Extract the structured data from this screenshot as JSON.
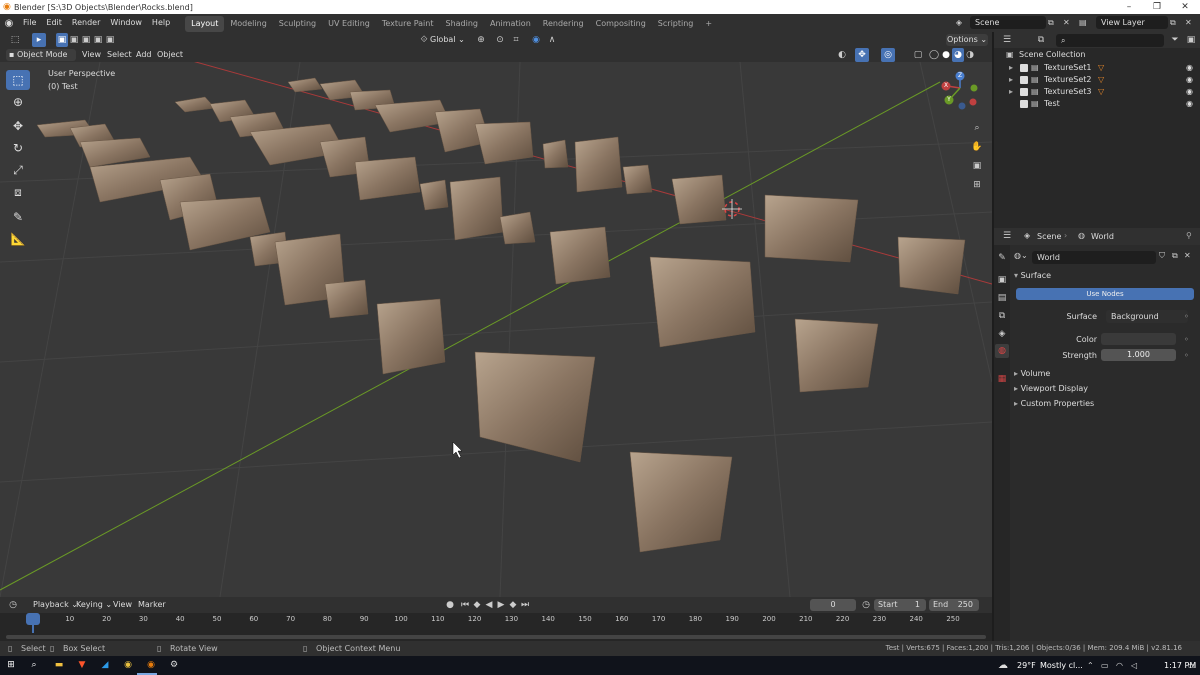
{
  "window": {
    "title": "Blender [S:\\3D Objects\\Blender\\Rocks.blend]",
    "minimize": "–",
    "maximize": "❐",
    "close": "✕"
  },
  "topbar": {
    "menus": [
      "File",
      "Edit",
      "Render",
      "Window",
      "Help"
    ],
    "workspaces": [
      "Layout",
      "Modeling",
      "Sculpting",
      "UV Editing",
      "Texture Paint",
      "Shading",
      "Animation",
      "Rendering",
      "Compositing",
      "Scripting"
    ],
    "active_workspace": "Layout",
    "add_workspace": "+",
    "scene": "Scene",
    "view_layer": "View Layer"
  },
  "tool_header": {
    "transform_orientation": "Global",
    "options": "Options"
  },
  "viewport_header": {
    "mode": "Object Mode",
    "menus": [
      "View",
      "Select",
      "Add",
      "Object"
    ]
  },
  "viewport": {
    "view_name": "User Perspective",
    "collection_info": "(0) Test",
    "gizmo": {
      "x": "X",
      "y": "Y",
      "z": "Z"
    }
  },
  "outliner": {
    "root": "Scene Collection",
    "items": [
      {
        "name": "TextureSet1"
      },
      {
        "name": "TextureSet2"
      },
      {
        "name": "TextureSet3"
      },
      {
        "name": "Test"
      }
    ]
  },
  "properties": {
    "breadcrumb_scene": "Scene",
    "breadcrumb_world": "World",
    "world_name": "World",
    "surface_panel": "Surface",
    "use_nodes": "Use Nodes",
    "surface_label": "Surface",
    "surface_value": "Background",
    "color_label": "Color",
    "strength_label": "Strength",
    "strength_value": "1.000",
    "collapsed_panels": [
      "Volume",
      "Viewport Display",
      "Custom Properties"
    ]
  },
  "timeline": {
    "menus": [
      "Playback",
      "Keying",
      "View",
      "Marker"
    ],
    "current_frame": "0",
    "start_label": "Start",
    "start_value": "1",
    "end_label": "End",
    "end_value": "250",
    "ticks": [
      "0",
      "10",
      "20",
      "30",
      "40",
      "50",
      "60",
      "70",
      "80",
      "90",
      "100",
      "110",
      "120",
      "130",
      "140",
      "150",
      "160",
      "170",
      "180",
      "190",
      "200",
      "210",
      "220",
      "230",
      "240",
      "250"
    ]
  },
  "statusbar": {
    "select": "Select",
    "box_select": "Box Select",
    "rotate_view": "Rotate View",
    "context_menu": "Object Context Menu",
    "stats": "Test | Verts:675 | Faces:1,200 | Tris:1,206 | Objects:0/36 | Mem: 209.4 MiB | v2.81.16"
  },
  "taskbar": {
    "weather_temp": "29°F",
    "weather_text": "Mostly cl...",
    "time": "1:17 PM"
  },
  "colors": {
    "accent_blue": "#4772b3",
    "x_axis": "#a83a3a",
    "y_axis": "#6a9a26",
    "rock": "#8a7562",
    "active_frame": "#4772b3"
  }
}
